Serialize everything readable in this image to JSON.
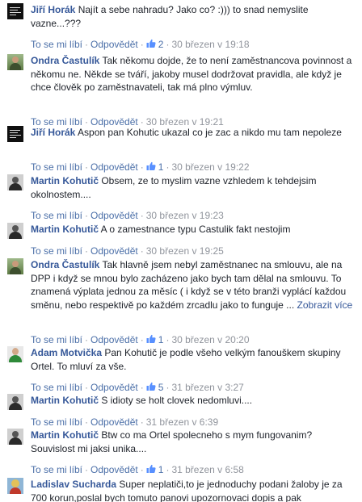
{
  "comments": [
    {
      "author": "Jiří Horák",
      "text": "Najít a sebe nahradu? Jako co? :))) to snad nemyslite vazne...???",
      "more": "",
      "like_label": "To se mi líbí",
      "reply_label": "Odpovědět",
      "likes": "2",
      "time": "30 březen v 19:18",
      "avatar": "dark-text"
    },
    {
      "author": "Ondra Častulík",
      "text": "Tak někomu dojde, že to není zaměstnancova povinnost a někomu ne. Někde se tváří, jakoby musel dodržovat pravidla, ale když je chce člověk po zaměstnavateli, tak má plno výmluv.",
      "more": "",
      "like_label": "To se mi líbí",
      "reply_label": "Odpovědět",
      "likes": "",
      "time": "30 březen v 19:21",
      "avatar": "outdoor"
    },
    {
      "author": "Jiří Horák",
      "text": "Aspon pan Kohutic ukazal co je zac a nikdo mu tam nepoleze",
      "more": "",
      "like_label": "To se mi líbí",
      "reply_label": "Odpovědět",
      "likes": "1",
      "time": "30 březen v 19:22",
      "avatar": "dark-text"
    },
    {
      "author": "Martin Kohutič",
      "text": "Obsem, ze to myslim vazne vzhledem k tehdejsim okolnostem....",
      "more": "",
      "like_label": "To se mi líbí",
      "reply_label": "Odpovědět",
      "likes": "",
      "time": "30 březen v 19:23",
      "avatar": "grey-person"
    },
    {
      "author": "Martin Kohutič",
      "text": "A o zamestnance typu Castulik fakt nestojim",
      "more": "",
      "like_label": "To se mi líbí",
      "reply_label": "Odpovědět",
      "likes": "",
      "time": "30 březen v 19:25",
      "avatar": "grey-person"
    },
    {
      "author": "Ondra Častulík",
      "text": "Tak hlavně jsem nebyl zaměstnanec na smlouvu, ale na DPP i když se mnou bylo zacházeno jako bych tam dělal na smlouvu. To znamená výplata jednou za měsíc ( i když se v této branži vyplácí každou směnu, nebo respektivě po každém zrcadlu jako to funguje ...",
      "more": "Zobrazit více",
      "like_label": "To se mi líbí",
      "reply_label": "Odpovědět",
      "likes": "1",
      "time": "30 březen v 20:20",
      "avatar": "outdoor"
    },
    {
      "author": "Adam Motvička",
      "text": "Pan Kohutič je podle všeho velkým fanouškem skupiny Ortel. To mluví za vše.",
      "more": "",
      "like_label": "To se mi líbí",
      "reply_label": "Odpovědět",
      "likes": "5",
      "time": "31 březen v 3:27",
      "avatar": "green-shirt"
    },
    {
      "author": "Martin Kohutič",
      "text": "S idioty se holt clovek nedomluvi....",
      "more": "",
      "like_label": "To se mi líbí",
      "reply_label": "Odpovědět",
      "likes": "",
      "time": "31 březen v 6:39",
      "avatar": "grey-person"
    },
    {
      "author": "Martin Kohutič",
      "text": "Btw co ma Ortel spolecneho s mym fungovanim? Souvislost mi jaksi unika....",
      "more": "",
      "like_label": "To se mi líbí",
      "reply_label": "Odpovědět",
      "likes": "1",
      "time": "31 březen v 6:58",
      "avatar": "grey-person"
    },
    {
      "author": "Ladislav Sucharda",
      "text": "Super neplatiči,to je jednoduchy podani žaloby je za 700 korun,poslal bych tomuto panovi upozornovaci dopis a pak",
      "more": "",
      "like_label": "",
      "reply_label": "",
      "likes": "",
      "time": "",
      "avatar": "blond"
    }
  ],
  "colors": {
    "author": "#365899",
    "action_link": "#4b6fa8",
    "meta": "#90949c",
    "text": "#1d2129"
  },
  "icons": {
    "like": "thumbs-up-icon"
  }
}
